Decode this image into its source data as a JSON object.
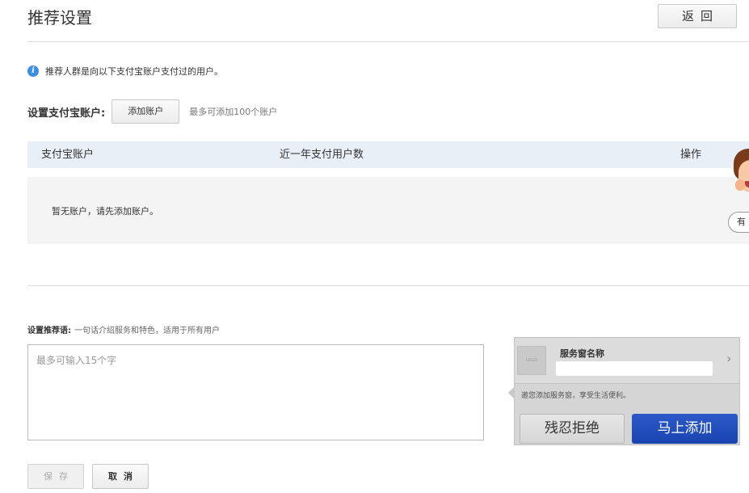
{
  "header": {
    "title": "推荐设置",
    "back_label": "返回"
  },
  "notice": {
    "icon": "info-icon",
    "icon_glyph": "i",
    "text": "推荐人群是向以下支付宝账户支付过的用户。"
  },
  "account": {
    "label": "设置支付宝账户:",
    "add_button_label": "添加账户",
    "hint": "最多可添加100个账户"
  },
  "table": {
    "columns": [
      "支付宝账户",
      "近一年支付用户数",
      "操作"
    ],
    "empty_text": "暂无账户，请先添加账户。"
  },
  "floating_widget": {
    "button_label": "有"
  },
  "phrase": {
    "label": "设置推荐语:",
    "hint": "一句话介绍服务和特色，适用于所有用户",
    "placeholder": "最多可输入15个字",
    "value": ""
  },
  "preview": {
    "logo_text": "LOGO",
    "name": "服务窗名称",
    "chevron": "›",
    "invite_text": "邀您添加服务窗，享受生活便利。",
    "reject_label": "残忍拒绝",
    "add_label": "马上添加"
  },
  "footer": {
    "save_label": "保存",
    "cancel_label": "取消"
  },
  "colors": {
    "table_header_bg": "#e8eff7",
    "empty_bg": "#f4f4f4",
    "info_blue": "#3a8ee6",
    "primary_blue": "#1a44b0"
  }
}
